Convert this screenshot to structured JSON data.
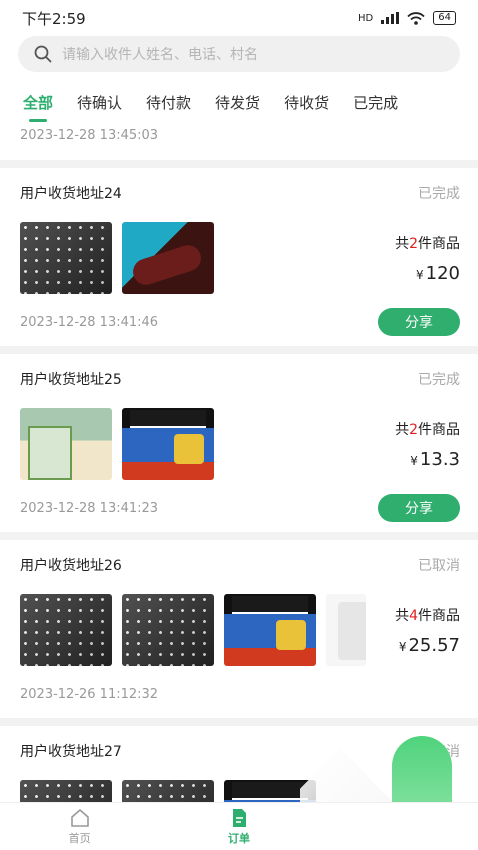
{
  "status_bar": {
    "time": "下午2:59",
    "network": "HD",
    "battery": "64"
  },
  "search": {
    "placeholder": "请输入收件人姓名、电话、村名"
  },
  "tabs": [
    {
      "label": "全部",
      "active": true
    },
    {
      "label": "待确认",
      "active": false
    },
    {
      "label": "待付款",
      "active": false
    },
    {
      "label": "待发货",
      "active": false
    },
    {
      "label": "待收货",
      "active": false
    },
    {
      "label": "已完成",
      "active": false
    }
  ],
  "top_date": "2023-12-28 13:45:03",
  "orders": [
    {
      "address": "用户收货地址24",
      "status": "已完成",
      "count_prefix": "共",
      "count": "2",
      "count_suffix": "件商品",
      "currency": "¥",
      "price": "120",
      "date": "2023-12-28 13:41:46",
      "share_label": "分享"
    },
    {
      "address": "用户收货地址25",
      "status": "已完成",
      "count_prefix": "共",
      "count": "2",
      "count_suffix": "件商品",
      "currency": "¥",
      "price": "13.3",
      "date": "2023-12-28 13:41:23",
      "share_label": "分享"
    },
    {
      "address": "用户收货地址26",
      "status": "已取消",
      "count_prefix": "共",
      "count": "4",
      "count_suffix": "件商品",
      "currency": "¥",
      "price": "25.57",
      "date": "2023-12-26 11:12:32"
    },
    {
      "address": "用户收货地址27",
      "status": "已取消"
    }
  ],
  "bottom_nav": [
    {
      "label": "首页",
      "icon": "home-icon",
      "active": false
    },
    {
      "label": "订单",
      "icon": "order-icon",
      "active": true
    }
  ],
  "colors": {
    "accent": "#2dae6f",
    "price_highlight": "#e02020"
  }
}
